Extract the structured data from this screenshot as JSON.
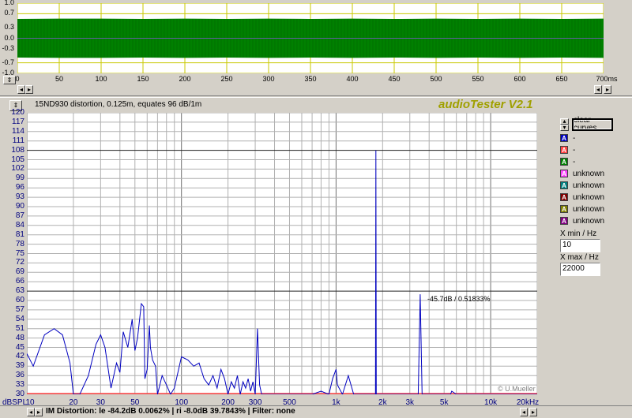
{
  "waveform": {
    "y_labels": [
      "1.0",
      "0.7",
      "0.3",
      "0.0",
      "-0.3",
      "-0.7",
      "-1.0"
    ],
    "x_labels": [
      "0",
      "50",
      "100",
      "150",
      "200",
      "250",
      "300",
      "350",
      "400",
      "450",
      "500",
      "550",
      "600",
      "650",
      "700ms"
    ],
    "colors": {
      "wave": "#008000",
      "background": "#ffffff",
      "grid": "#c8c800"
    }
  },
  "header": {
    "title": "15ND930 distortion, 0.125m, equates 96 dB/1m",
    "brand": "audioTester V2.1"
  },
  "spectrum": {
    "y_labels": [
      "120",
      "117",
      "114",
      "111",
      "108",
      "105",
      "102",
      "99",
      "96",
      "93",
      "90",
      "87",
      "84",
      "81",
      "78",
      "75",
      "72",
      "69",
      "66",
      "63",
      "60",
      "57",
      "54",
      "51",
      "48",
      "45",
      "42",
      "39",
      "36",
      "33",
      "30"
    ],
    "y_unit": "dBSPL",
    "x_labels": [
      "10",
      "20",
      "30",
      "50",
      "100",
      "200",
      "300",
      "500",
      "1k",
      "2k",
      "3k",
      "5k",
      "10k",
      "20kHz"
    ],
    "annotation": "-45.7dB / 0.51833%",
    "copyright": "© U.Mueller"
  },
  "sidebar": {
    "clear_label": "clear curves",
    "curve_letter": "A",
    "legend": [
      {
        "label": "-",
        "color": "#0000c0"
      },
      {
        "label": "-",
        "color": "#ff4040"
      },
      {
        "label": "-",
        "color": "#008000"
      },
      {
        "label": "unknown",
        "color": "#ff40ff"
      },
      {
        "label": "unknown",
        "color": "#008080"
      },
      {
        "label": "unknown",
        "color": "#800000"
      },
      {
        "label": "unknown",
        "color": "#808000"
      },
      {
        "label": "unknown",
        "color": "#800080"
      }
    ],
    "xmin_label": "X min / Hz",
    "xmin_value": "10",
    "xmax_label": "X max / Hz",
    "xmax_value": "22000"
  },
  "status": {
    "text": "IM Distortion: le -84.2dB  0.0062% | ri -8.0dB  39.7843% |  Filter:  none"
  },
  "chart_data": [
    {
      "type": "line",
      "title": "",
      "xlabel": "",
      "ylabel": "",
      "xlim": [
        0,
        700
      ],
      "ylim": [
        -1.0,
        1.0
      ],
      "series": [
        {
          "envelope_upper": [
            0.55,
            0.56,
            0.56,
            0.55,
            0.56,
            0.55,
            0.56,
            0.55,
            0.56,
            0.55,
            0.56,
            0.55,
            0.56,
            0.55,
            0.56
          ],
          "envelope_lower": [
            -0.55,
            -0.56,
            -0.56,
            -0.55,
            -0.56,
            -0.55,
            -0.56,
            -0.55,
            -0.56,
            -0.55,
            -0.56,
            -0.55,
            -0.56,
            -0.55,
            -0.56
          ],
          "x": [
            0,
            50,
            100,
            150,
            200,
            250,
            300,
            350,
            400,
            450,
            500,
            550,
            600,
            650,
            700
          ]
        }
      ]
    },
    {
      "type": "line",
      "title": "15ND930 distortion, 0.125m, equates 96 dB/1m",
      "xlabel": "",
      "ylabel": "dBSPL",
      "x_scale": "log",
      "xlim": [
        10,
        20000
      ],
      "ylim": [
        30,
        120
      ],
      "series": [
        {
          "x": [
            10,
            11,
            13,
            15,
            17,
            19,
            20,
            22,
            25,
            28,
            30,
            32,
            35,
            38,
            40,
            42,
            45,
            48,
            50,
            52,
            55,
            57,
            58,
            60,
            62,
            63,
            65,
            68,
            70,
            75,
            80,
            85,
            90,
            100,
            110,
            120,
            130,
            140,
            150,
            160,
            170,
            180,
            190,
            200,
            210,
            220,
            230,
            240,
            250,
            260,
            270,
            280,
            290,
            300,
            310,
            320,
            330,
            350,
            400,
            500,
            600,
            700,
            800,
            900,
            950,
            1000,
            1020,
            1100,
            1200,
            1300,
            1500,
            1700,
            1800,
            1810,
            1820,
            1900,
            2000,
            2500,
            3000,
            3400,
            3500,
            3600,
            3700,
            4000,
            5000,
            5500,
            5600,
            6000,
            8000,
            10000,
            15000,
            20000
          ],
          "y": [
            43,
            39,
            49,
            51,
            49,
            40,
            30,
            30,
            36,
            46,
            49,
            45,
            32,
            40,
            37,
            50,
            45,
            54,
            44,
            48,
            59,
            58,
            35,
            38,
            52,
            45,
            41,
            39,
            30,
            36,
            33,
            30,
            32,
            42,
            41,
            39,
            40,
            35,
            33,
            36,
            32,
            38,
            35,
            30,
            34,
            32,
            36,
            30,
            34,
            32,
            35,
            31,
            34,
            30,
            51,
            33,
            30,
            30,
            30,
            30,
            30,
            30,
            31,
            30,
            35,
            38,
            33,
            30,
            36,
            30,
            30,
            30,
            30,
            108,
            30,
            30,
            30,
            30,
            30,
            30,
            62,
            30,
            30,
            30,
            30,
            30,
            31,
            30,
            30,
            30,
            30,
            30
          ]
        }
      ]
    }
  ]
}
